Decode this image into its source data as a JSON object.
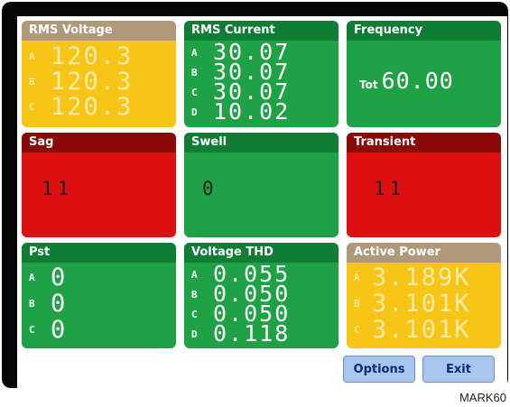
{
  "tiles": {
    "rms_voltage": {
      "title": "RMS Voltage",
      "rows": [
        {
          "label": "A",
          "value": "120.3"
        },
        {
          "label": "B",
          "value": "120.3"
        },
        {
          "label": "C",
          "value": "120.3"
        }
      ]
    },
    "rms_current": {
      "title": "RMS Current",
      "rows": [
        {
          "label": "A",
          "value": "30.07"
        },
        {
          "label": "B",
          "value": "30.07"
        },
        {
          "label": "C",
          "value": "30.07"
        },
        {
          "label": "D",
          "value": "10.02"
        }
      ]
    },
    "frequency": {
      "title": "Frequency",
      "label": "Tot",
      "value": "60.00"
    },
    "sag": {
      "title": "Sag",
      "value": "11"
    },
    "swell": {
      "title": "Swell",
      "value": "0"
    },
    "transient": {
      "title": "Transient",
      "value": "11"
    },
    "pst": {
      "title": "Pst",
      "rows": [
        {
          "label": "A",
          "value": "0"
        },
        {
          "label": "B",
          "value": "0"
        },
        {
          "label": "C",
          "value": "0"
        }
      ]
    },
    "voltage_thd": {
      "title": "Voltage THD",
      "rows": [
        {
          "label": "A",
          "value": "0.055"
        },
        {
          "label": "B",
          "value": "0.050"
        },
        {
          "label": "C",
          "value": "0.050"
        },
        {
          "label": "D",
          "value": "0.118"
        }
      ]
    },
    "active_power": {
      "title": "Active Power",
      "rows": [
        {
          "label": "A",
          "value": "3.189K"
        },
        {
          "label": "B",
          "value": "3.101K"
        },
        {
          "label": "C",
          "value": "3.101K"
        }
      ]
    }
  },
  "buttons": {
    "options": "Options",
    "exit": "Exit"
  },
  "figure_mark": "MARK60",
  "colors": {
    "yellow": "#f7c516",
    "green": "#1fa245",
    "red": "#dc1010",
    "header_green": "#0f7d34",
    "header_red": "#8a0a0a",
    "header_tan": "#b0997b",
    "button": "#a9c7ee"
  }
}
